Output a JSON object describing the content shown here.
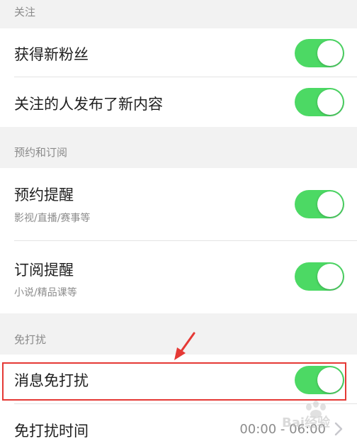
{
  "sections": {
    "follow": {
      "header": "关注",
      "items": [
        {
          "title": "获得新粉丝",
          "enabled": true
        },
        {
          "title": "关注的人发布了新内容",
          "enabled": true
        }
      ]
    },
    "reservation": {
      "header": "预约和订阅",
      "items": [
        {
          "title": "预约提醒",
          "subtitle": "影视/直播/赛事等",
          "enabled": true
        },
        {
          "title": "订阅提醒",
          "subtitle": "小说/精品课等",
          "enabled": true
        }
      ]
    },
    "dnd": {
      "header": "免打扰",
      "toggle_item": {
        "title": "消息免打扰",
        "enabled": true
      },
      "time_item": {
        "title": "免打扰时间",
        "value": "00:00 - 06:00"
      }
    }
  },
  "colors": {
    "toggle_on": "#4cd964",
    "highlight": "#e53935",
    "background": "#f2f2f2"
  },
  "icons": {
    "chevron": "chevron-right-icon",
    "arrow": "red-arrow-icon",
    "watermark": "baidu-jingyan-watermark"
  },
  "watermark": {
    "text": "Bai经验"
  }
}
